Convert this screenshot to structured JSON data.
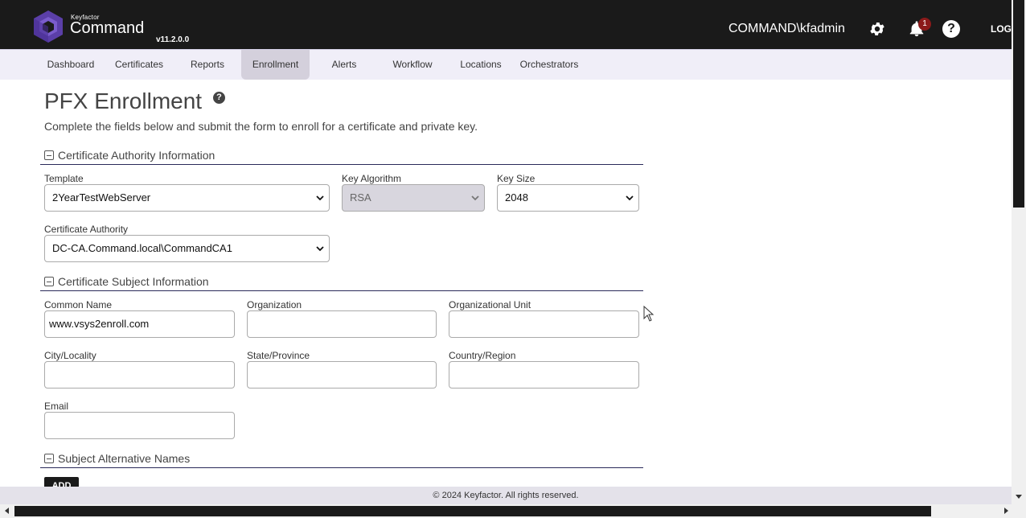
{
  "header": {
    "brand_small": "Keyfactor",
    "brand_main": "Command",
    "version": "v11.2.0.0",
    "user": "COMMAND\\kfadmin",
    "notification_count": "1",
    "help_glyph": "?",
    "logout_label": "LOGOUT"
  },
  "nav": {
    "items": [
      {
        "label": "Dashboard"
      },
      {
        "label": "Certificates"
      },
      {
        "label": "Reports"
      },
      {
        "label": "Enrollment"
      },
      {
        "label": "Alerts"
      },
      {
        "label": "Workflow"
      },
      {
        "label": "Locations"
      },
      {
        "label": "Orchestrators"
      }
    ],
    "active": "Enrollment"
  },
  "page": {
    "title": "PFX Enrollment",
    "subtitle": "Complete the fields below and submit the form to enroll for a certificate and private key."
  },
  "ca_section": {
    "title": "Certificate Authority Information",
    "template_label": "Template",
    "template_value": "2YearTestWebServer",
    "key_algorithm_label": "Key Algorithm",
    "key_algorithm_value": "RSA",
    "key_size_label": "Key Size",
    "key_size_value": "2048",
    "ca_label": "Certificate Authority",
    "ca_value": "DC-CA.Command.local\\CommandCA1"
  },
  "subject_section": {
    "title": "Certificate Subject Information",
    "common_name_label": "Common Name",
    "common_name_value": "www.vsys2enroll.com",
    "organization_label": "Organization",
    "organization_value": "",
    "org_unit_label": "Organizational Unit",
    "org_unit_value": "",
    "city_label": "City/Locality",
    "city_value": "",
    "state_label": "State/Province",
    "state_value": "",
    "country_label": "Country/Region",
    "country_value": "",
    "email_label": "Email",
    "email_value": ""
  },
  "san_section": {
    "title": "Subject Alternative Names",
    "add_label": "ADD"
  },
  "footer": {
    "text": "© 2024 Keyfactor. All rights reserved."
  },
  "colors": {
    "header_bg": "#1a1a1a",
    "nav_bg": "#f0eef8",
    "active_tab": "#d4d0dc",
    "badge": "#8b1a1a",
    "section_rule": "#2a2a5a",
    "logo_purple": "#5b3fa8"
  },
  "icons": [
    "keyfactor-logo-icon",
    "gear-icon",
    "bell-icon",
    "help-icon",
    "collapse-icon",
    "chevron-down-icon"
  ]
}
